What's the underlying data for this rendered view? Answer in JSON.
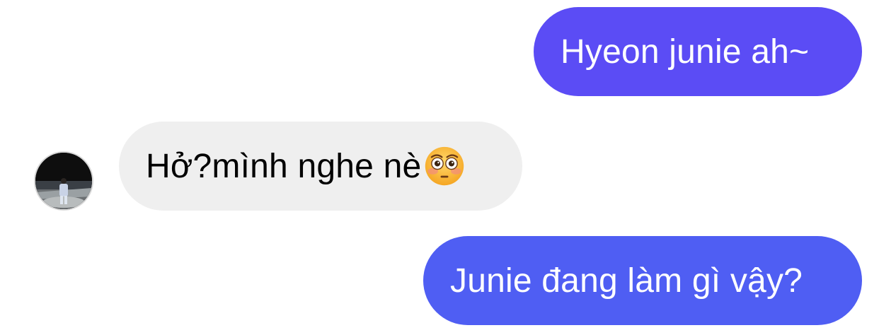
{
  "conversation": {
    "messages": [
      {
        "sender": "me",
        "text": "Hyeon junie ah~"
      },
      {
        "sender": "contact",
        "text": "Hở?mình nghe nè",
        "emoji": "flushed-face-emoji"
      },
      {
        "sender": "me",
        "text": "Junie đang làm gì vậy?"
      }
    ]
  },
  "colors": {
    "sent_bubble_top": "#5b4cf5",
    "sent_bubble_bottom": "#4f5ef3",
    "received_bubble": "#efefef",
    "sent_text": "#ffffff",
    "received_text": "#000000"
  },
  "icons": {
    "avatar": "contact-avatar-photo",
    "emoji": "flushed-face-emoji"
  }
}
